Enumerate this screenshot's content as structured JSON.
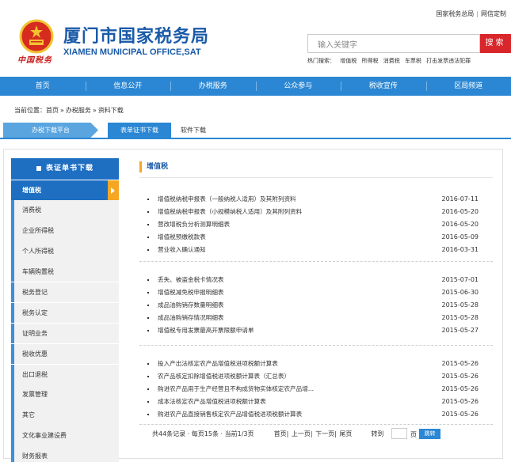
{
  "header": {
    "top_links": [
      "国家税务总局",
      "网信定制"
    ],
    "title_cn": "厦门市国家税务局",
    "title_en": "XIAMEN MUNICIPAL OFFICE,SAT",
    "search_placeholder": "输入关键字",
    "search_button": "搜索",
    "hot_search_label": "热门搜索：",
    "hot_search_items": [
      "增值税",
      "所得税",
      "消费税",
      "车票税",
      "打击发票违法犯罪"
    ]
  },
  "nav": {
    "items": [
      "首页",
      "信息公开",
      "办税服务",
      "公众参与",
      "税收宣传",
      "区局频道"
    ]
  },
  "breadcrumb": {
    "label": "当前位置：",
    "parts": [
      "首页",
      "办税服务",
      "资料下载"
    ],
    "sep": "»"
  },
  "subtabs": {
    "tab_a": "办税下载平台",
    "tab_b": "表单证书下载",
    "tab_c": "软件下载"
  },
  "sidebar": {
    "heading": "表证单书下载",
    "items": [
      "增值税",
      "消费税",
      "企业所得税",
      "个人所得税",
      "车辆购置税",
      "税务登记",
      "税务认定",
      "证明业务",
      "税收优惠",
      "出口退税",
      "发票管理",
      "其它",
      "文化事业建设费",
      "财务报表"
    ],
    "active_index": 0
  },
  "main": {
    "title": "增值税",
    "groups": [
      [
        {
          "text": "增值税纳税申报表（一般纳税人适用）及其附列资料",
          "date": "2016-07-11"
        },
        {
          "text": "增值税纳税申报表（小规模纳税人适用）及其附列资料",
          "date": "2016-05-20"
        },
        {
          "text": "营改增税负分析测算明细表",
          "date": "2016-05-20"
        },
        {
          "text": "增值税预缴税款表",
          "date": "2016-05-09"
        },
        {
          "text": "营业收入确认通知",
          "date": "2016-03-31"
        }
      ],
      [
        {
          "text": "丢失、被盗金税卡情况表",
          "date": "2015-07-01"
        },
        {
          "text": "增值税减免税申报明细表",
          "date": "2015-06-30"
        },
        {
          "text": "成品油购销存数量明细表",
          "date": "2015-05-28"
        },
        {
          "text": "成品油购销存情况明细表",
          "date": "2015-05-28"
        },
        {
          "text": "增值税专用发票最高开票限额申请单",
          "date": "2015-05-27"
        }
      ],
      [
        {
          "text": "投入产出法核定农产品增值税进项税额计算表",
          "date": "2015-05-26"
        },
        {
          "text": "农产品核定扣除增值税进项税额计算表（汇总表）",
          "date": "2015-05-26"
        },
        {
          "text": "购进农产品用于生产经营且不构成货物实体核定农产品增...",
          "date": "2015-05-26"
        },
        {
          "text": "成本法核定农产品增值税进项税额计算表",
          "date": "2015-05-26"
        },
        {
          "text": "购进农产品直接销售核定农产品增值税进项税额计算表",
          "date": "2015-05-26"
        }
      ]
    ]
  },
  "pager": {
    "summary": "共44条记录 · 每页15条 · 当前1/3页",
    "first": "首页|",
    "prev": "上一页|",
    "next": "下一页|",
    "last": "尾页",
    "goto_label": "转到",
    "page_unit": "页",
    "jump_button": "跳转"
  },
  "brand_script": "中国税务",
  "colors": {
    "nav_blue": "#2b87d3",
    "title_blue": "#1a5aa8",
    "accent_orange": "#f5a623",
    "search_red": "#d9262b"
  }
}
